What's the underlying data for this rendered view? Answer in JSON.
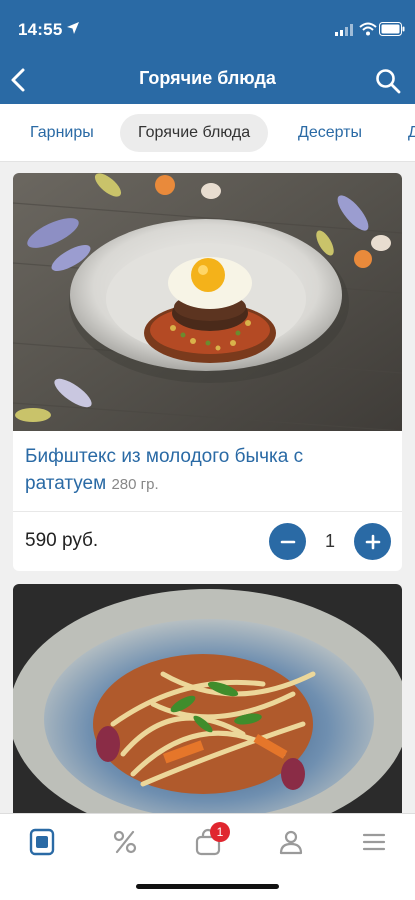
{
  "status": {
    "time": "14:55"
  },
  "header": {
    "title": "Горячие блюда"
  },
  "tabs": [
    {
      "label": "Гарниры"
    },
    {
      "label": "Горячие блюда"
    },
    {
      "label": "Десерты"
    },
    {
      "label": "Д"
    }
  ],
  "dishes": [
    {
      "name": "Бифштекс из молодого бычка с рататуем",
      "weight": "280 гр.",
      "price": "590 руб.",
      "quantity": "1"
    }
  ],
  "tabbar": {
    "items": [
      {
        "icon": "menu-book-icon",
        "active": true
      },
      {
        "icon": "percent-icon"
      },
      {
        "icon": "cart-icon",
        "badge": "1"
      },
      {
        "icon": "profile-icon"
      },
      {
        "icon": "hamburger-icon"
      }
    ]
  },
  "colors": {
    "brand": "#2a6aa5",
    "badge": "#e0262f",
    "inactive_icon": "#9a9a9a"
  }
}
